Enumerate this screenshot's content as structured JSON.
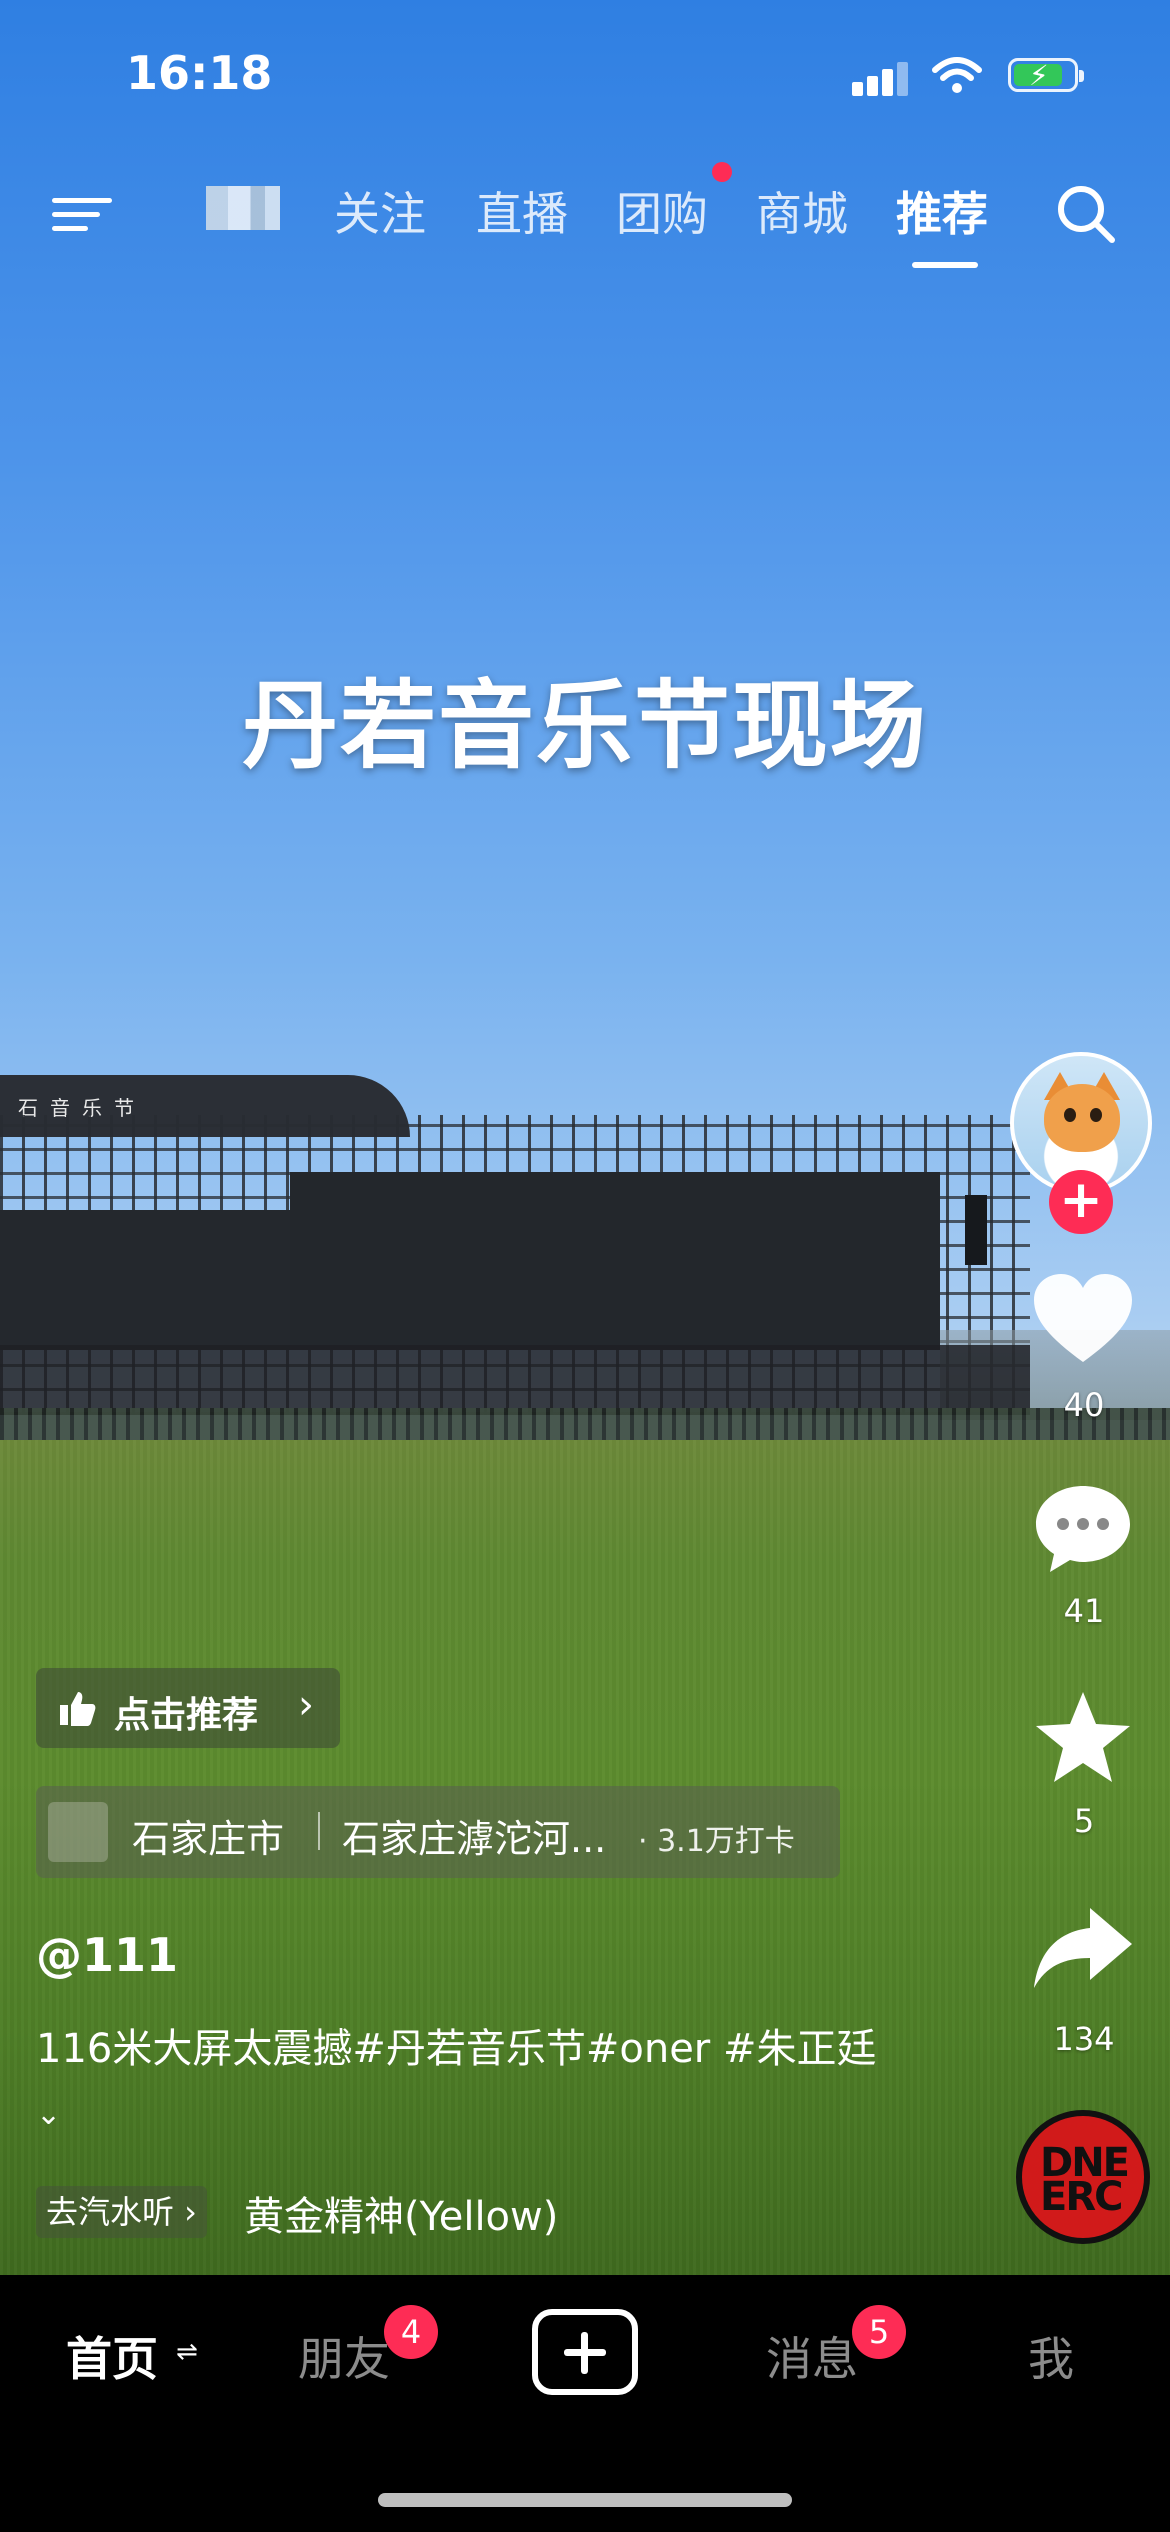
{
  "status_bar": {
    "time": "16:18",
    "icons": [
      "cellular-signal-icon",
      "wifi-icon",
      "battery-charging-icon"
    ],
    "battery_level": 0.8
  },
  "top_nav": {
    "tabs": [
      {
        "label": "关注"
      },
      {
        "label": "直播"
      },
      {
        "label": "团购",
        "has_dot": true
      },
      {
        "label": "商城"
      },
      {
        "label": "推荐",
        "active": true
      }
    ],
    "icons": [
      "menu-icon",
      "search-icon"
    ]
  },
  "video": {
    "overlay_title": "丹若音乐节现场",
    "stage_banner_text": "石音乐节"
  },
  "actions": {
    "likes": "40",
    "comments": "41",
    "favorites": "5",
    "shares": "134",
    "follow_symbol": "+"
  },
  "recommend_chip": {
    "label": "点击推荐",
    "chevron": "›"
  },
  "location_chip": {
    "city": "石家庄市",
    "place": "石家庄滹沱河...",
    "checkins": "· 3.1万打卡"
  },
  "author": "@111",
  "caption": {
    "text": "116米大屏太震撼#丹若音乐节#oner #朱正廷",
    "more_icon": "⌄"
  },
  "music": {
    "go_listen": "去汽水听 ›",
    "song": "黄金精神(Yellow)",
    "disc_text": "DNE ERC"
  },
  "bottom_nav": {
    "items": [
      {
        "label": "首页",
        "active": true,
        "suffix": "⇌"
      },
      {
        "label": "朋友",
        "badge": "4"
      },
      {
        "label": "消息",
        "badge": "5"
      },
      {
        "label": "我"
      }
    ]
  },
  "colors": {
    "accent": "#fe2c55",
    "battery": "#33c759"
  }
}
